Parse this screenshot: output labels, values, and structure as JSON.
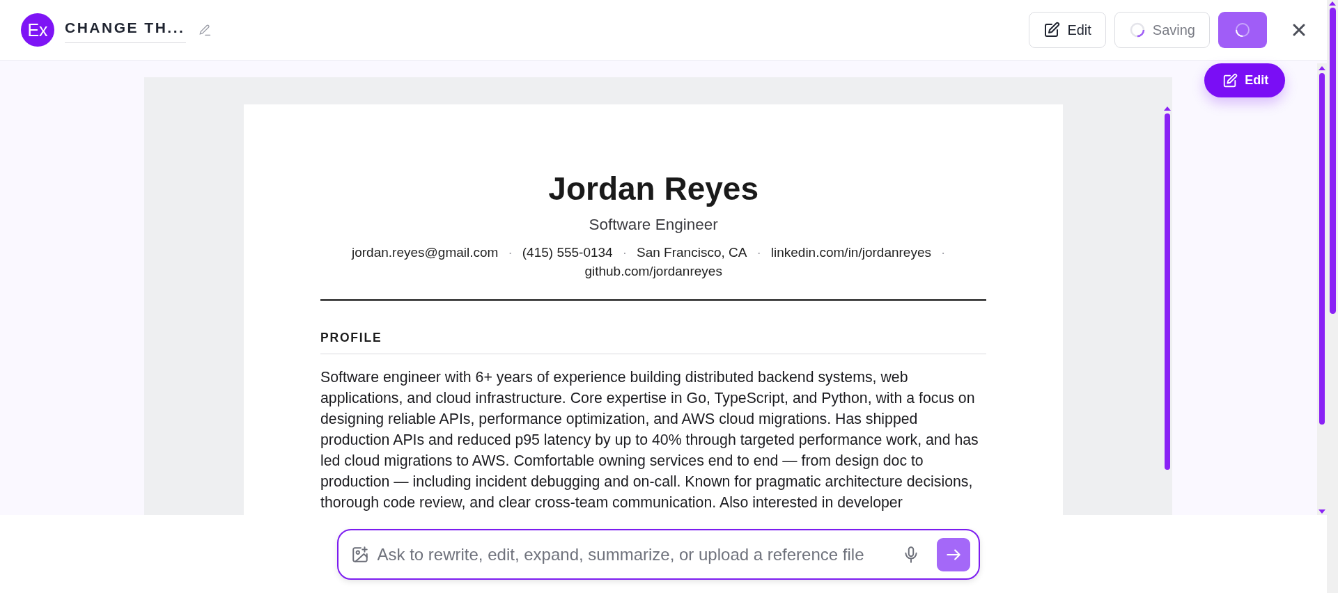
{
  "header": {
    "avatar": "Ex",
    "title": "CHANGE TH...",
    "buttons": [
      {
        "kind": "edit",
        "label": "Edit"
      },
      {
        "kind": "saving",
        "label": "Saving"
      },
      {
        "kind": "loading"
      }
    ]
  },
  "floating_button": {
    "label": "Edit"
  },
  "resume": {
    "name": "Jordan Reyes",
    "role": "Software Engineer",
    "separator": "·",
    "contacts": [
      "jordan.reyes@gmail.com",
      "(415) 555-0134",
      "San Francisco, CA",
      "linkedin.com/in/jordanreyes",
      "github.com/jordanreyes"
    ],
    "sections": [
      {
        "heading": "PROFILE",
        "text": "Software engineer with 6+ years of experience building distributed backend systems, web applications, and cloud infrastructure. Core expertise in Go, TypeScript, and Python, with a focus on designing reliable APIs, performance optimization, and AWS cloud migrations. Has shipped production APIs and reduced p95 latency by up to 40% through targeted performance work, and has led cloud migrations to AWS. Comfortable owning services end to end — from design doc to production — including incident debugging and on-call. Known for pragmatic architecture decisions, thorough code review, and clear cross-team communication. Also interested in developer"
      }
    ]
  },
  "composer": {
    "placeholder": "Ask to rewrite, edit, expand, summarize, or upload a reference file"
  }
}
